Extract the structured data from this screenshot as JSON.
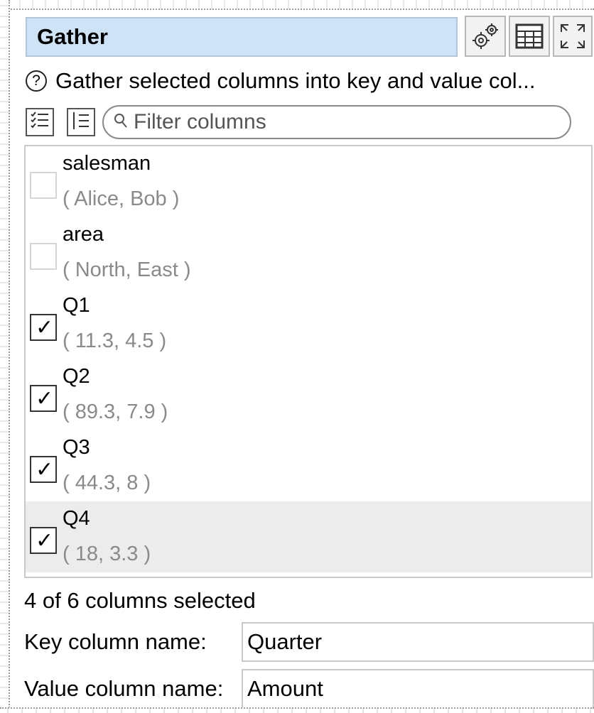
{
  "header": {
    "title": "Gather",
    "settings_icon": "gears-icon",
    "table_icon": "table-icon",
    "expand_icon": "expand-icon"
  },
  "help": {
    "icon": "?",
    "text": "Gather selected columns into key and value col..."
  },
  "toolbar": {
    "select_all_icon": "checklist-icon",
    "select_none_icon": "list-icon",
    "filter_placeholder": "Filter columns"
  },
  "columns": [
    {
      "name": "salesman",
      "values": "( Alice, Bob )",
      "checked": false
    },
    {
      "name": "area",
      "values": "( North, East )",
      "checked": false
    },
    {
      "name": "Q1",
      "values": "( 11.3, 4.5 )",
      "checked": true
    },
    {
      "name": "Q2",
      "values": "( 89.3, 7.9 )",
      "checked": true
    },
    {
      "name": "Q3",
      "values": "( 44.3, 8 )",
      "checked": true
    },
    {
      "name": "Q4",
      "values": "( 18, 3.3 )",
      "checked": true
    }
  ],
  "checkmark": "✓",
  "status": "4 of 6 columns selected",
  "key_field": {
    "label": "Key column name:",
    "value": "Quarter"
  },
  "value_field": {
    "label": "Value column name:",
    "value": "Amount"
  },
  "colors": {
    "title_bg": "#cfe3f7",
    "highlight_row": "#ececec"
  }
}
